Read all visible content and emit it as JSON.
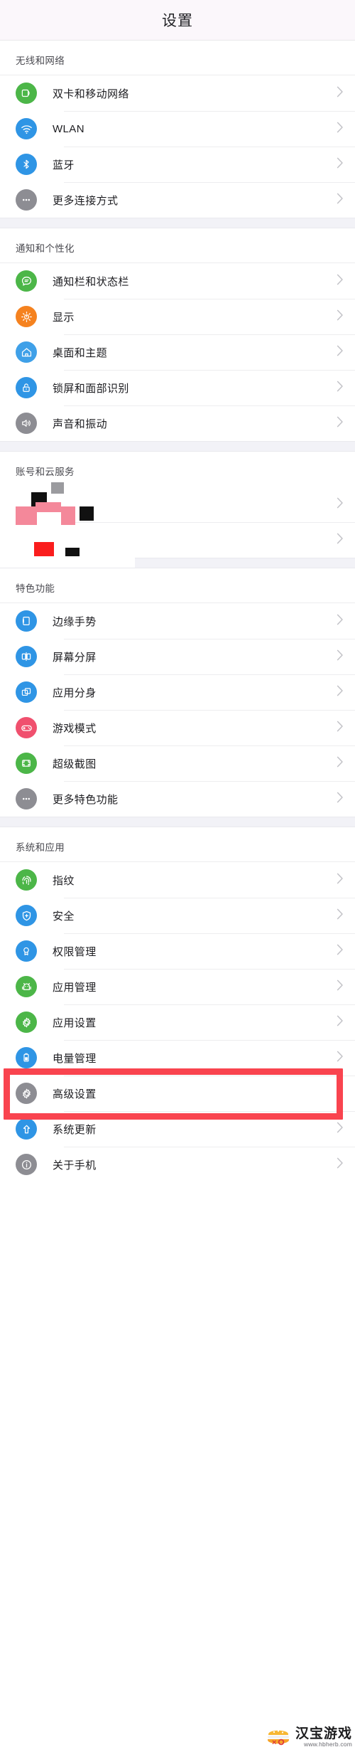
{
  "header": {
    "title": "设置"
  },
  "groups": [
    {
      "name": "wireless-and-network",
      "heading": "无线和网络",
      "items": [
        {
          "label": "双卡和移动网络",
          "icon": "sim-card-icon",
          "color": "#4cb648"
        },
        {
          "label": "WLAN",
          "icon": "wifi-icon",
          "color": "#2f95e5"
        },
        {
          "label": "蓝牙",
          "icon": "bluetooth-icon",
          "color": "#2f95e5"
        },
        {
          "label": "更多连接方式",
          "icon": "more-dots-icon",
          "color": "#8d8d93"
        }
      ]
    },
    {
      "name": "notification-and-personalization",
      "heading": "通知和个性化",
      "items": [
        {
          "label": "通知栏和状态栏",
          "icon": "chat-bubble-icon",
          "color": "#4cb648"
        },
        {
          "label": "显示",
          "icon": "brightness-icon",
          "color": "#f5821f"
        },
        {
          "label": "桌面和主题",
          "icon": "home-icon",
          "color": "#3fa0e8"
        },
        {
          "label": "锁屏和面部识别",
          "icon": "lock-icon",
          "color": "#2f95e5"
        },
        {
          "label": "声音和振动",
          "icon": "speaker-icon",
          "color": "#8d8d93"
        }
      ]
    },
    {
      "name": "accounts-and-cloud",
      "heading": "账号和云服务",
      "redacted": true,
      "items": [
        {
          "label": "",
          "icon": "redacted-icon",
          "color": "#ffffff"
        },
        {
          "label": "",
          "icon": "redacted-icon",
          "color": "#ffffff"
        }
      ]
    },
    {
      "name": "special-features",
      "heading": "特色功能",
      "items": [
        {
          "label": "边缘手势",
          "icon": "edge-gesture-icon",
          "color": "#2f95e5"
        },
        {
          "label": "屏幕分屏",
          "icon": "split-screen-icon",
          "color": "#2f95e5"
        },
        {
          "label": "应用分身",
          "icon": "app-clone-icon",
          "color": "#2f95e5"
        },
        {
          "label": "游戏模式",
          "icon": "gamepad-icon",
          "color": "#f0506e"
        },
        {
          "label": "超级截图",
          "icon": "screenshot-icon",
          "color": "#4cb648"
        },
        {
          "label": "更多特色功能",
          "icon": "more-dots-icon",
          "color": "#8d8d93"
        }
      ]
    },
    {
      "name": "system-and-apps",
      "heading": "系统和应用",
      "items": [
        {
          "label": "指纹",
          "icon": "fingerprint-icon",
          "color": "#4cb648"
        },
        {
          "label": "安全",
          "icon": "shield-icon",
          "color": "#2f95e5"
        },
        {
          "label": "权限管理",
          "icon": "badge-icon",
          "color": "#2f95e5"
        },
        {
          "label": "应用管理",
          "icon": "android-icon",
          "color": "#4cb648"
        },
        {
          "label": "应用设置",
          "icon": "gear-icon",
          "color": "#4cb648"
        },
        {
          "label": "电量管理",
          "icon": "battery-icon",
          "color": "#2f95e5"
        },
        {
          "label": "高级设置",
          "icon": "gear-icon",
          "color": "#8d8d93"
        },
        {
          "label": "系统更新",
          "icon": "upgrade-arrow-icon",
          "color": "#2f95e5"
        },
        {
          "label": "关于手机",
          "icon": "info-icon",
          "color": "#8d8d93",
          "highlighted": true
        }
      ]
    }
  ],
  "highlight": {
    "color": "#f9444f"
  },
  "watermark": {
    "name": "汉宝游戏",
    "url": "www.hbherb.com"
  }
}
